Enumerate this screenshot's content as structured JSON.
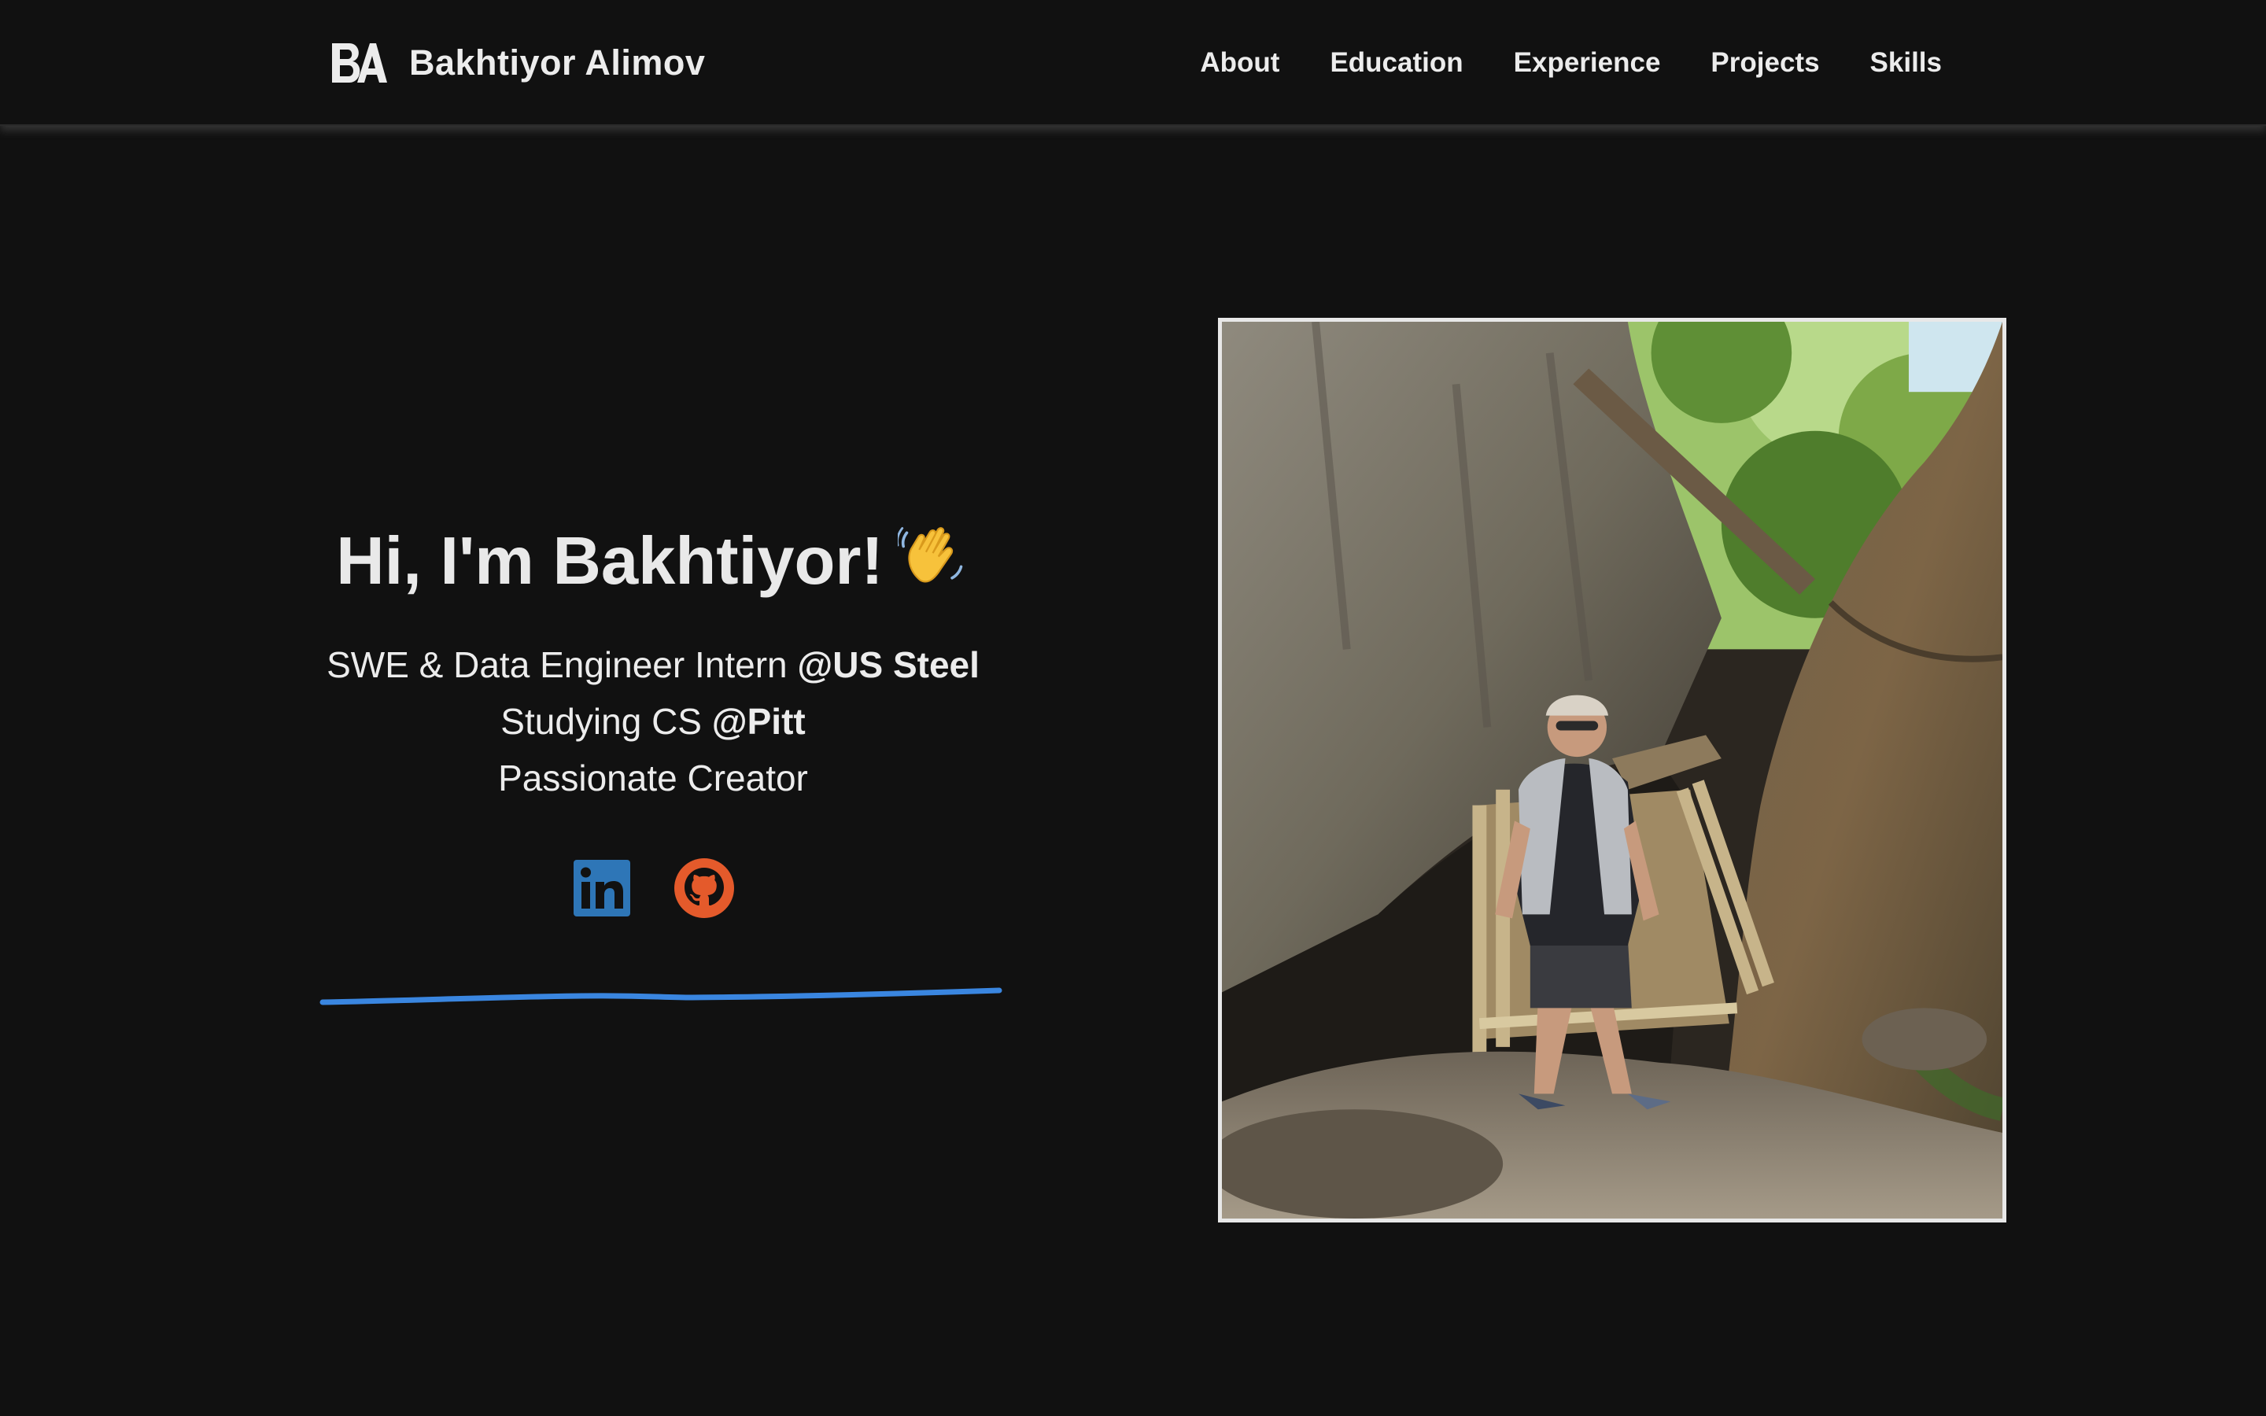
{
  "nav": {
    "brand_name": "Bakhtiyor Alimov",
    "logo_icon": "ba-monogram-logo",
    "links": [
      "About",
      "Education",
      "Experience",
      "Projects",
      "Skills"
    ]
  },
  "hero": {
    "greeting": "Hi, I'm Bakhtiyor!",
    "greeting_icon": "waving-hand-icon",
    "line1_prefix": "SWE & Data Engineer Intern ",
    "line1_highlight": "@US Steel",
    "line2_prefix": "Studying CS ",
    "line2_highlight": "@Pitt",
    "line3": "Passionate Creator"
  },
  "socials": [
    {
      "icon": "linkedin-icon",
      "color": "#2e76b7"
    },
    {
      "icon": "github-icon",
      "color": "#e45a2b"
    }
  ],
  "colors": {
    "background": "#111111",
    "text": "#ececec",
    "underline": "#3a86e0",
    "photo_border": "#e8e8e8"
  },
  "photo": {
    "description_icon": "profile-photo"
  }
}
